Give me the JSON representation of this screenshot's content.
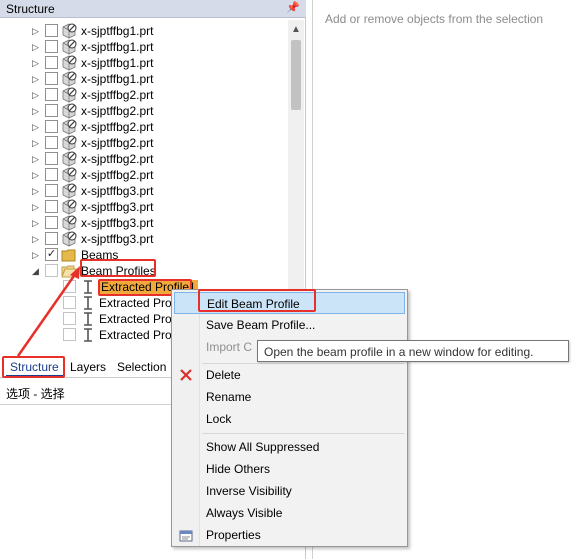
{
  "panel": {
    "title": "Structure",
    "pin": "ᵖ"
  },
  "tree": {
    "parts": [
      "x-sjptffbg1.prt",
      "x-sjptffbg1.prt",
      "x-sjptffbg1.prt",
      "x-sjptffbg1.prt",
      "x-sjptffbg2.prt",
      "x-sjptffbg2.prt",
      "x-sjptffbg2.prt",
      "x-sjptffbg2.prt",
      "x-sjptffbg2.prt",
      "x-sjptffbg2.prt",
      "x-sjptffbg3.prt",
      "x-sjptffbg3.prt",
      "x-sjptffbg3.prt",
      "x-sjptffbg3.prt"
    ],
    "beams_label": "Beams",
    "beam_profiles_label": "Beam Profiles",
    "profiles": [
      "Extracted Profile1",
      "Extracted Prof",
      "Extracted Prof",
      "Extracted Prof"
    ]
  },
  "tabs": {
    "structure": "Structure",
    "layers": "Layers",
    "selection": "Selection"
  },
  "status": "选项 - 选择",
  "right_hint": "Add or remove objects from the selection",
  "menu": {
    "edit": "Edit Beam Profile",
    "save": "Save Beam Profile...",
    "import": "Import C",
    "delete": "Delete",
    "rename": "Rename",
    "lock": "Lock",
    "show_suppressed": "Show All Suppressed",
    "hide_others": "Hide Others",
    "inverse": "Inverse Visibility",
    "always_visible": "Always Visible",
    "properties": "Properties"
  },
  "tooltip": "Open the beam profile in a new window for editing.",
  "colors": {
    "highlight": "#cce4f7",
    "annotation_red": "#e8302a",
    "folder": "#e6b84a"
  }
}
